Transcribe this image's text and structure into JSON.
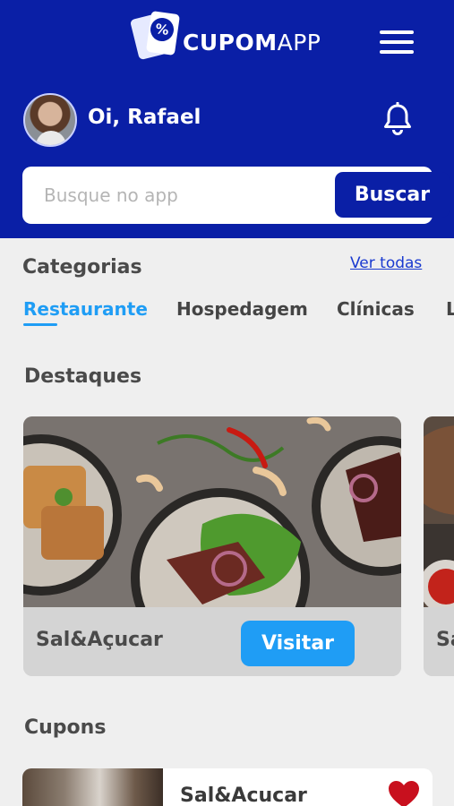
{
  "header": {
    "logo_bold": "CUPOM",
    "logo_light": "APP",
    "logo_badge": "%",
    "greeting": "Oi, Rafael",
    "icons": {
      "menu": "hamburger-menu-icon",
      "notifications": "bell-icon"
    },
    "brand_color": "#0a1fa6"
  },
  "search": {
    "placeholder": "Busque no app",
    "button_label": "Buscar"
  },
  "categories": {
    "title": "Categorias",
    "see_all": "Ver todas",
    "tabs": [
      {
        "label": "Restaurante",
        "active": true
      },
      {
        "label": "Hospedagem",
        "active": false
      },
      {
        "label": "Clínicas",
        "active": false
      },
      {
        "label": "L",
        "active": false
      }
    ],
    "accent_color": "#1f9df5"
  },
  "highlights": {
    "title": "Destaques",
    "cards": [
      {
        "name": "Sal&Açucar",
        "button_label": "Visitar"
      },
      {
        "name": "Sa",
        "button_label": ""
      }
    ]
  },
  "coupons": {
    "title": "Cupons",
    "items": [
      {
        "name": "Sal&Acucar",
        "favorite": true,
        "favorite_color": "#c8101e"
      }
    ]
  }
}
